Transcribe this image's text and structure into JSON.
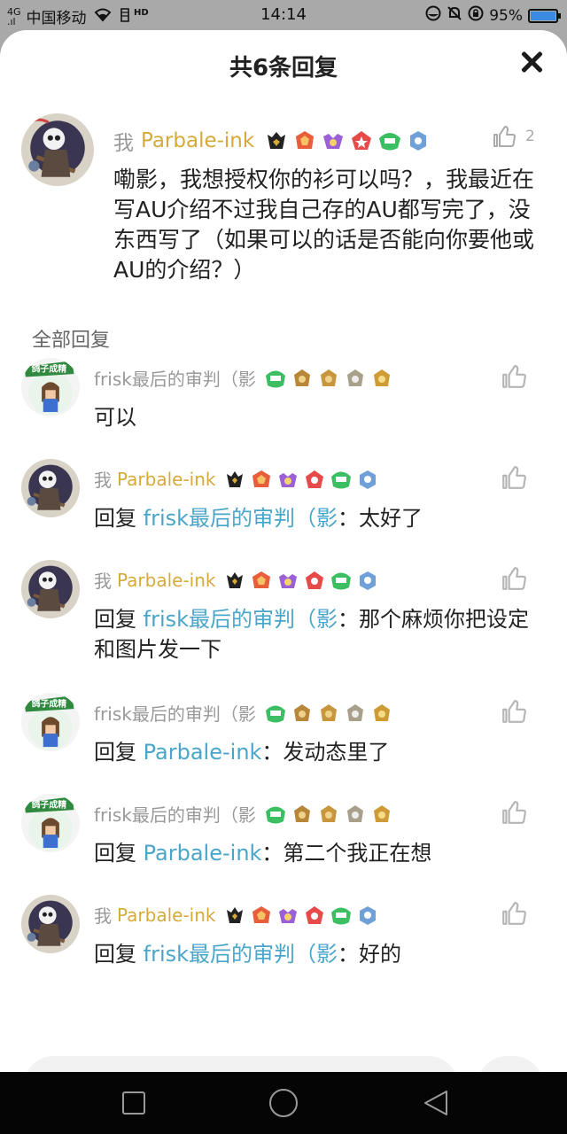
{
  "status_bar": {
    "carrier": "中国移动",
    "network": "HD",
    "time": "14:14",
    "battery": "95%",
    "battery_fraction": 0.95,
    "icons": [
      "signal-icon",
      "wifi-icon",
      "hd-icon",
      "eye-care-icon",
      "mute-icon",
      "lock-rotation-icon",
      "battery-icon"
    ]
  },
  "sheet": {
    "title": "共6条回复",
    "close_icon": "close-icon"
  },
  "main_comment": {
    "me_tag": "我",
    "username": "Parbale-ink",
    "like_count": "2",
    "text": "嘞影，我想授权你的衫可以吗？，我最近在写AU介绍不过我自己存的AU都写完了，没东西写了（如果可以的话是否能向你要他或AU的介绍？）"
  },
  "section_title": "全部回复",
  "replies": [
    {
      "author_me": "",
      "author": "frisk最后的审判（影",
      "prefix": "",
      "target": "",
      "text": "可以",
      "avatar": "frisk",
      "badge_set": "frisk"
    },
    {
      "author_me": "我",
      "author": "Parbale-ink",
      "prefix": "回复 ",
      "target": "frisk最后的审判（影",
      "text": "：太好了",
      "avatar": "parbale",
      "badge_set": "parbale"
    },
    {
      "author_me": "我",
      "author": "Parbale-ink",
      "prefix": "回复 ",
      "target": "frisk最后的审判（影",
      "text": "：那个麻烦你把设定和图片发一下",
      "avatar": "parbale",
      "badge_set": "parbale"
    },
    {
      "author_me": "",
      "author": "frisk最后的审判（影",
      "prefix": "回复 ",
      "target": "Parbale-ink",
      "text": "：发动态里了",
      "avatar": "frisk",
      "badge_set": "frisk"
    },
    {
      "author_me": "",
      "author": "frisk最后的审判（影",
      "prefix": "回复 ",
      "target": "Parbale-ink",
      "text": "：第二个我正在想",
      "avatar": "frisk",
      "badge_set": "frisk"
    },
    {
      "author_me": "我",
      "author": "Parbale-ink",
      "prefix": "回复 ",
      "target": "frisk最后的审判（影",
      "text": "：好的",
      "avatar": "parbale",
      "badge_set": "parbale"
    }
  ],
  "avatar_sticker": "鸽子成精",
  "colors": {
    "gold_name": "#d5aa3a",
    "link": "#4aa6c9",
    "gray": "#999999"
  }
}
